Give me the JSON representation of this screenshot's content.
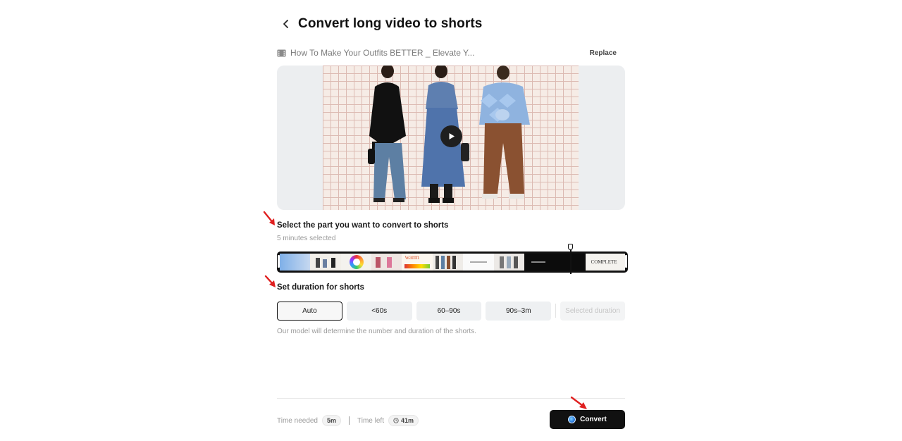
{
  "header": {
    "title": "Convert long video to shorts"
  },
  "file": {
    "name": "How To Make Your Outfits BETTER _ Elevate Y...",
    "replace_label": "Replace"
  },
  "select_part": {
    "title": "Select the part you want to convert to shorts",
    "subtitle": "5 minutes selected"
  },
  "timeline": {
    "thumb_texts": [
      "",
      "",
      "",
      "",
      "warm",
      "",
      "",
      "",
      "",
      "",
      "COMPLETE"
    ]
  },
  "duration": {
    "title": "Set duration for shorts",
    "options": [
      "Auto",
      "<60s",
      "60–90s",
      "90s–3m"
    ],
    "selected_option": "Auto",
    "selected_duration_label": "Selected duration",
    "hint": "Our model will determine the number and duration of the shorts."
  },
  "footer": {
    "time_needed_label": "Time needed",
    "time_needed_value": "5m",
    "time_left_label": "Time left",
    "time_left_value": "41m",
    "convert_label": "Convert"
  },
  "colors": {
    "accent": "#111111",
    "annotation_arrow": "#e02020"
  },
  "icons": [
    "chevron-left-icon",
    "film-icon",
    "play-icon",
    "clock-icon",
    "ai-orb-icon",
    "red-arrow-annotation"
  ]
}
